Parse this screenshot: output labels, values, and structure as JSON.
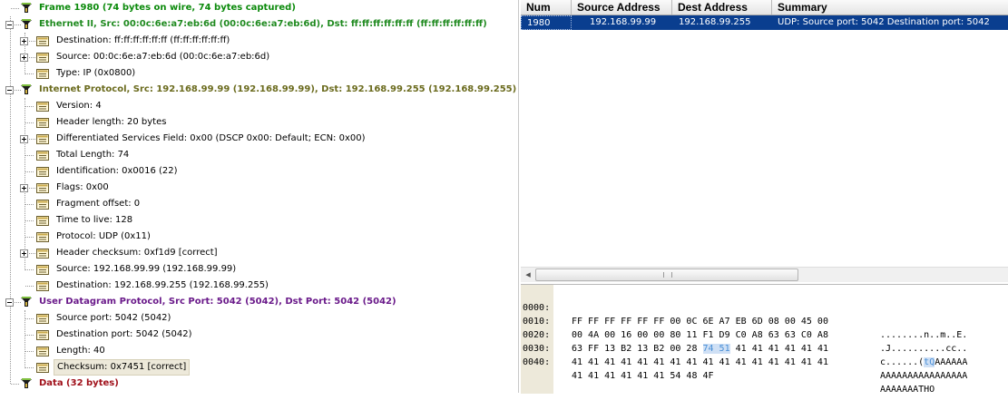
{
  "tree": {
    "frame": "Frame 1980 (74 bytes on wire, 74 bytes captured)",
    "ethernet": {
      "title": "Ethernet II, Src: 00:0c:6e:a7:eb:6d (00:0c:6e:a7:eb:6d), Dst: ff:ff:ff:ff:ff:ff (ff:ff:ff:ff:ff:ff)",
      "destination": "Destination: ff:ff:ff:ff:ff:ff (ff:ff:ff:ff:ff:ff)",
      "source": "Source: 00:0c:6e:a7:eb:6d (00:0c:6e:a7:eb:6d)",
      "type": "Type: IP (0x0800)"
    },
    "ip": {
      "title": "Internet Protocol, Src: 192.168.99.99 (192.168.99.99), Dst: 192.168.99.255 (192.168.99.255)",
      "version": "Version: 4",
      "header_length": "Header length: 20 bytes",
      "dsf": "Differentiated Services Field: 0x00 (DSCP 0x00: Default; ECN: 0x00)",
      "total_length": "Total Length: 74",
      "identification": "Identification: 0x0016 (22)",
      "flags": "Flags: 0x00",
      "fragment_offset": "Fragment offset: 0",
      "ttl": "Time to live: 128",
      "protocol": "Protocol: UDP (0x11)",
      "checksum": "Header checksum: 0xf1d9 [correct]",
      "source": "Source: 192.168.99.99 (192.168.99.99)",
      "destination": "Destination: 192.168.99.255 (192.168.99.255)"
    },
    "udp": {
      "title": "User Datagram Protocol, Src Port: 5042 (5042), Dst Port: 5042 (5042)",
      "source_port": "Source port: 5042 (5042)",
      "destination_port": "Destination port: 5042 (5042)",
      "length": "Length: 40",
      "checksum": "Checksum: 0x7451 [correct]"
    },
    "data": "Data (32 bytes)"
  },
  "packet_list": {
    "columns": [
      "Num",
      "Source Address",
      "Dest Address",
      "Summary"
    ],
    "rows": [
      {
        "num": "1980",
        "src": "192.168.99.99",
        "dst": "192.168.99.255",
        "summary": "UDP: Source port: 5042  Destination port: 5042"
      }
    ]
  },
  "hex": {
    "rows": [
      {
        "offset": "0000:",
        "bytes": "FF FF FF FF FF FF 00 0C 6E A7 EB 6D 08 00 45 00",
        "ascii": "........n..m..E."
      },
      {
        "offset": "0010:",
        "bytes": "00 4A 00 16 00 00 80 11 F1 D9 C0 A8 63 63 C0 A8",
        "ascii": ".J..........cc.."
      },
      {
        "offset": "0020:",
        "bytes_pre": "63 FF 13 B2 13 B2 00 28 ",
        "bytes_hl": "74 51",
        "bytes_post": " 41 41 41 41 41 41",
        "ascii_pre": "c......(",
        "ascii_hl": "tQ",
        "ascii_post": "AAAAAA"
      },
      {
        "offset": "0030:",
        "bytes": "41 41 41 41 41 41 41 41 41 41 41 41 41 41 41 41",
        "ascii": "AAAAAAAAAAAAAAAA"
      },
      {
        "offset": "0040:",
        "bytes": "41 41 41 41 41 41 54 48 4F",
        "ascii": "AAAAAAATHO"
      }
    ]
  },
  "colors": {
    "selection": "#0a3e8f",
    "hex_highlight": "#cfe0f5",
    "offset_bg": "#ede9da"
  },
  "icons": {
    "tree_protocol": "protocol-tree-icon",
    "tree_field": "field-icon",
    "expander": "expander-icon"
  }
}
